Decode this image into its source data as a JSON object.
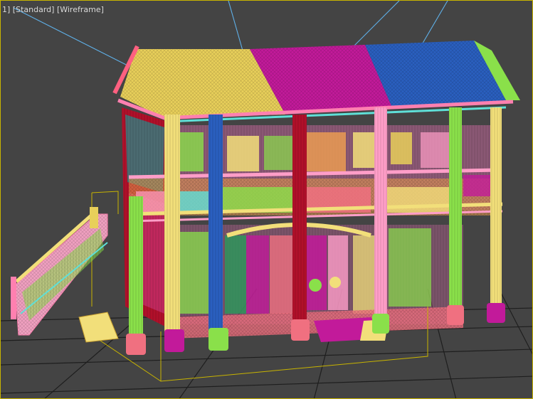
{
  "viewport": {
    "label_parts": [
      "1]",
      "[Standard]",
      "[Wireframe]"
    ],
    "background": "#444444",
    "border_color": "#c8b400"
  },
  "scene": {
    "view": "perspective",
    "render_mode": "wireframe",
    "object": "two-story house with tiled roof, balconies and side staircase",
    "colors": {
      "roof_yellow": "#e8cf5a",
      "roof_magenta": "#c21a9a",
      "roof_blue": "#2a5fbf",
      "pink": "#ff9ec8",
      "red": "#b0102a",
      "green": "#8ae04a",
      "cyan": "#5fe0d8",
      "orange": "#f0a050",
      "light_yellow": "#f2df7a",
      "selection_box": "#c8b400",
      "grid": "#1e1e1e",
      "light_line": "#5fb0e8"
    }
  }
}
